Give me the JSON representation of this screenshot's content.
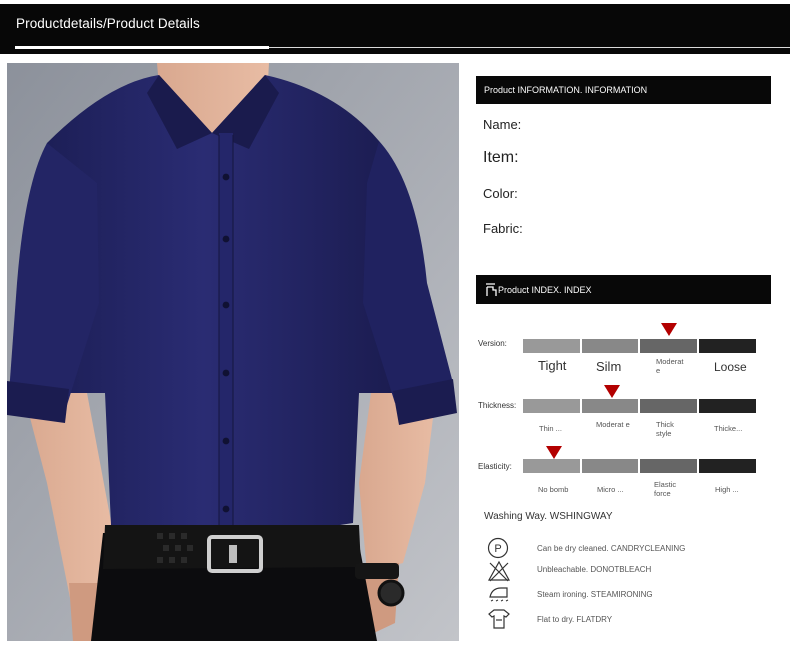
{
  "header": {
    "title": "Productdetails/Product Details"
  },
  "info_section": {
    "title": "Product INFORMATION. INFORMATION",
    "fields": [
      {
        "label": "Name:"
      },
      {
        "label": "Item:"
      },
      {
        "label": "Color:"
      },
      {
        "label": "Fabric:"
      }
    ]
  },
  "index_section": {
    "title": "Product INDEX. INDEX",
    "rows": [
      {
        "label": "Version:",
        "selected_index": 2,
        "options": [
          "Tight",
          "Silm",
          "Moderat e",
          "Loose"
        ]
      },
      {
        "label": "Thickness:",
        "selected_index": 1,
        "options": [
          "Thin ...",
          "Moderat e",
          "Thick style",
          "Thicke..."
        ]
      },
      {
        "label": "Elasticity:",
        "selected_index": 0,
        "options": [
          "No bomb",
          "Micro ...",
          "Elastic force",
          "High ..."
        ]
      }
    ],
    "segment_colors": [
      "#999999",
      "#888888",
      "#666666",
      "#222222"
    ],
    "marker_color": "#b30000"
  },
  "washing": {
    "title": "Washing Way. WSHINGWAY",
    "items": [
      {
        "icon": "dry-clean-icon",
        "text": "Can be dry cleaned. CANDRYCLEANING"
      },
      {
        "icon": "no-bleach-icon",
        "text": "Unbleachable. DONOTBLEACH"
      },
      {
        "icon": "steam-iron-icon",
        "text": "Steam ironing. STEAMIRONING"
      },
      {
        "icon": "flat-dry-icon",
        "text": "Flat to dry. FLATDRY"
      }
    ]
  }
}
